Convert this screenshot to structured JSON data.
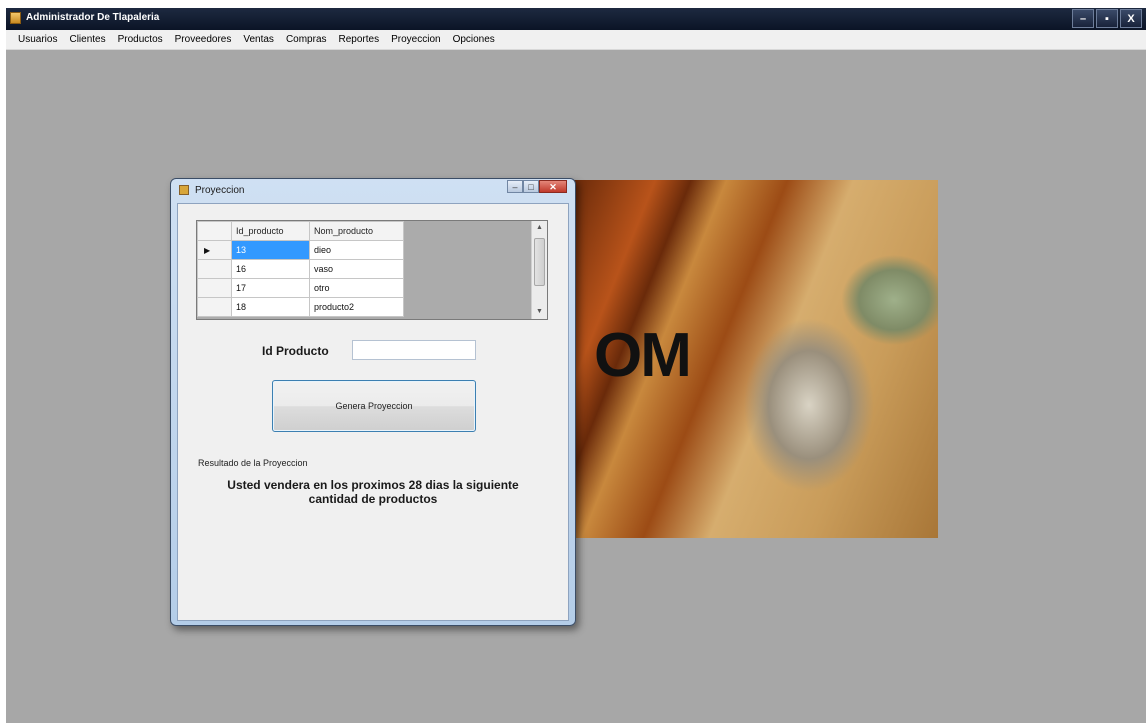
{
  "app": {
    "title": "Administrador De Tlapaleria",
    "controls": {
      "minimize": "–",
      "maximize": "▪",
      "close": "X"
    }
  },
  "menu": {
    "items": [
      "Usuarios",
      "Clientes",
      "Productos",
      "Proveedores",
      "Ventas",
      "Compras",
      "Reportes",
      "Proyeccion",
      "Opciones"
    ]
  },
  "background": {
    "photo_text": "OM"
  },
  "dialog": {
    "title": "Proyeccion",
    "grid": {
      "columns": [
        "Id_producto",
        "Nom_producto"
      ],
      "current_row_marker": "▶",
      "rows": [
        {
          "id": "13",
          "nombre": "dieo"
        },
        {
          "id": "16",
          "nombre": "vaso"
        },
        {
          "id": "17",
          "nombre": "otro"
        },
        {
          "id": "18",
          "nombre": "producto2"
        }
      ]
    },
    "id_label": "Id Producto",
    "id_value": "",
    "generate_button": "Genera Proyeccion",
    "result_label": "Resultado de la Proyeccion",
    "result_text": "Usted vendera en los proximos 28 dias la siguiente cantidad de productos"
  }
}
